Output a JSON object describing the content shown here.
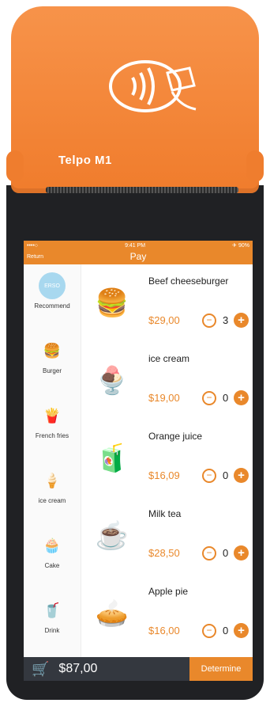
{
  "device": {
    "brand": "Telpo M1"
  },
  "status": {
    "carrier": "••••○ ",
    "time": "9:41 PM",
    "battery": "✈ 90%"
  },
  "nav": {
    "return_label": "Return",
    "title": "Pay"
  },
  "sidebar": {
    "items": [
      {
        "label": "Recommend",
        "icon": "recommend-icon"
      },
      {
        "label": "Burger",
        "icon": "burger-icon"
      },
      {
        "label": "French fries",
        "icon": "fries-icon"
      },
      {
        "label": "ice cream",
        "icon": "icecream-icon"
      },
      {
        "label": "Cake",
        "icon": "cake-icon"
      },
      {
        "label": "Drink",
        "icon": "drink-icon"
      }
    ]
  },
  "products": [
    {
      "name": "Beef cheeseburger",
      "price": "$29,00",
      "qty": "3",
      "icon": "burger-icon"
    },
    {
      "name": "ice cream",
      "price": "$19,00",
      "qty": "0",
      "icon": "icecream-icon"
    },
    {
      "name": "Orange juice",
      "price": "$16,09",
      "qty": "0",
      "icon": "juice-icon"
    },
    {
      "name": "Milk tea",
      "price": "$28,50",
      "qty": "0",
      "icon": "milk-tea-icon"
    },
    {
      "name": "Apple pie",
      "price": "$16,00",
      "qty": "0",
      "icon": "pie-icon"
    }
  ],
  "footer": {
    "total": "$87,00",
    "button": "Determine"
  }
}
